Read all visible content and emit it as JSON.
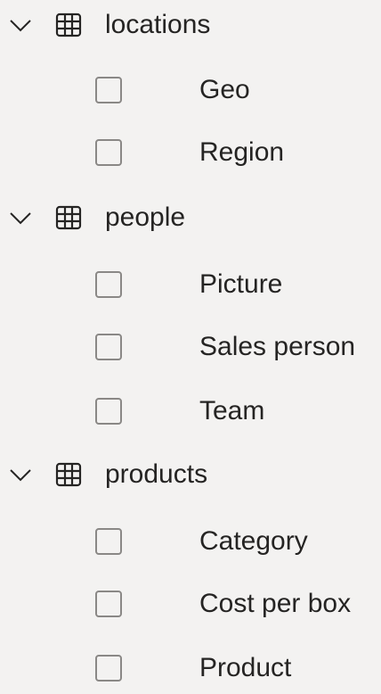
{
  "tables": [
    {
      "name": "locations",
      "expanded": true,
      "fields": [
        {
          "label": "Geo",
          "checked": false
        },
        {
          "label": "Region",
          "checked": false
        }
      ]
    },
    {
      "name": "people",
      "expanded": true,
      "fields": [
        {
          "label": "Picture",
          "checked": false
        },
        {
          "label": "Sales person",
          "checked": false
        },
        {
          "label": "Team",
          "checked": false
        }
      ]
    },
    {
      "name": "products",
      "expanded": true,
      "fields": [
        {
          "label": "Category",
          "checked": false
        },
        {
          "label": "Cost per box",
          "checked": false
        },
        {
          "label": "Product",
          "checked": false
        }
      ]
    }
  ],
  "icons": {
    "expand": "chevron-down-icon",
    "table": "table-icon"
  },
  "colors": {
    "background": "#f3f2f1",
    "text": "#252423",
    "checkbox_border": "#8a8886"
  }
}
